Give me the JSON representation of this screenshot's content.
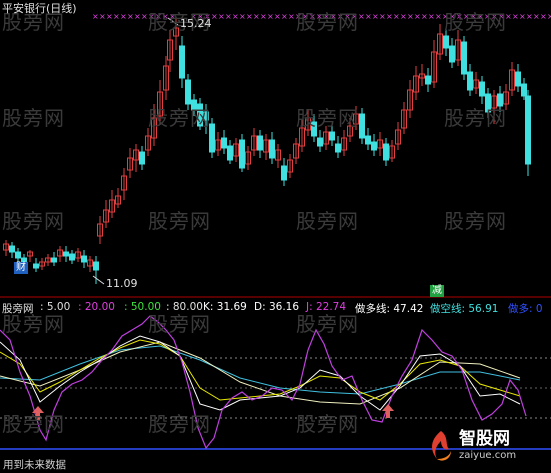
{
  "title": "平安银行(日线)",
  "price_labels": {
    "high": "15.24",
    "low": "11.09"
  },
  "badges": {
    "cai": "财",
    "jian": "减"
  },
  "indicator": {
    "name": "股旁网",
    "p1": ": 5.00",
    "p2": ": 20.00",
    "p3": ": 50.00",
    "p4": ": 80.00",
    "k": "K: 31.69",
    "d": "D: 36.16",
    "j": "J: 22.74",
    "duo": "做多线: 47.42",
    "kong": "做空线: 56.91",
    "duo2": "做多: 0"
  },
  "footer": "用到未来数据",
  "watermark": "股旁网",
  "logo": {
    "name": "智股网",
    "url": "zaiyue.com"
  },
  "colors": {
    "up": "#e04040",
    "down": "#40e0e0",
    "k": "#ffffff",
    "d": "#e8e800",
    "j": "#c040e0",
    "grid": "#b00000",
    "cross": "#e040e0"
  }
}
